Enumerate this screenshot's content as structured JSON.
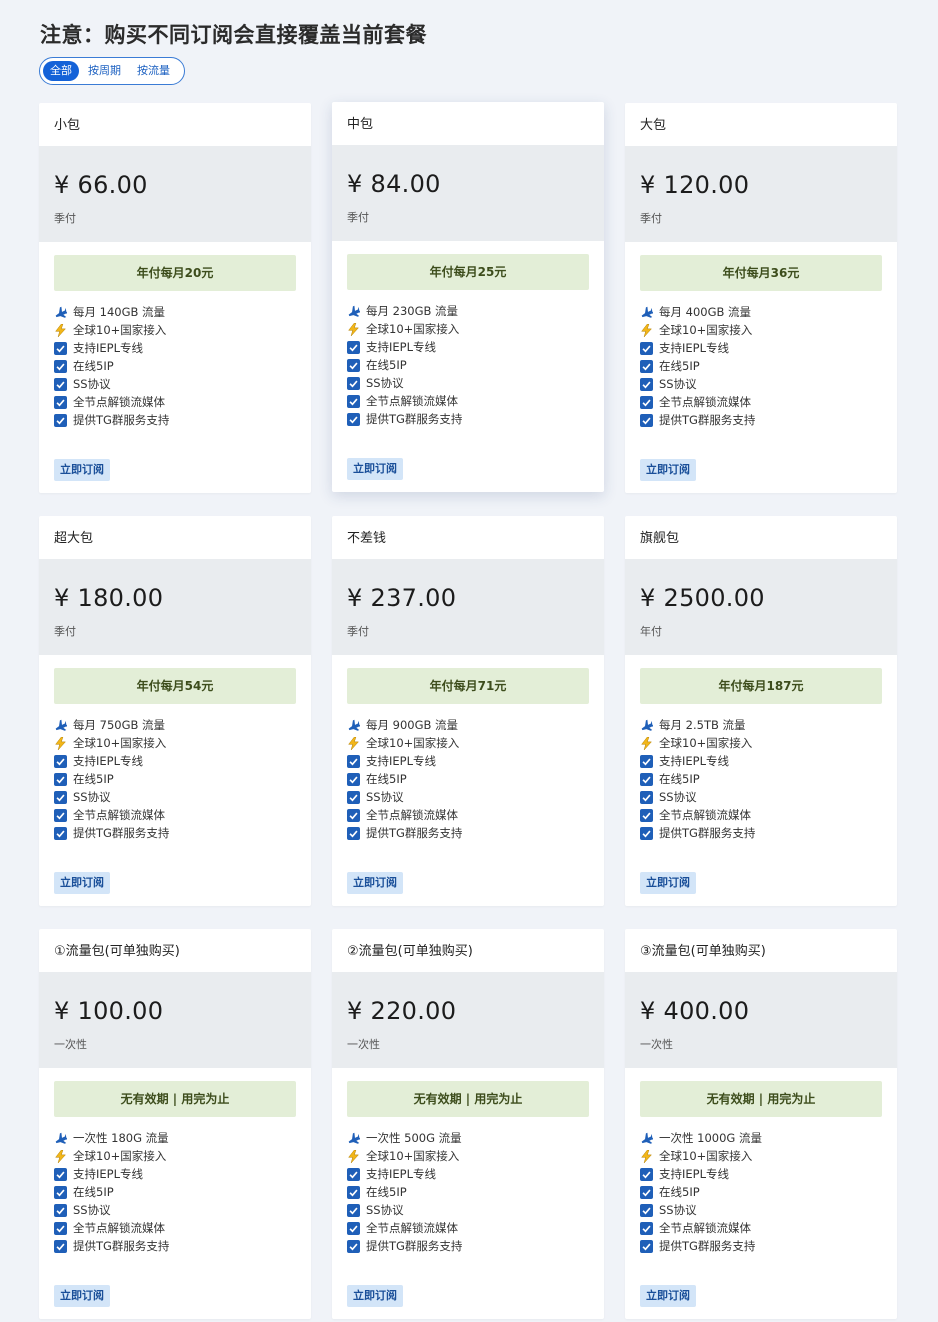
{
  "notice": "注意：购买不同订阅会直接覆盖当前套餐",
  "filter": {
    "tabs": [
      "全部",
      "按周期",
      "按流量"
    ],
    "active": "全部"
  },
  "buy_label": "立即订阅",
  "icon_colors": {
    "check": "#1f5fb8",
    "plane": "#1f5fb8",
    "bolt": "#f2b619"
  },
  "plans": [
    {
      "name": "小包",
      "price": "¥ 66.00",
      "period": "季付",
      "promo": "年付每月20元",
      "features": [
        "每月 140GB 流量",
        "全球10+国家接入",
        "支持IEPL专线",
        "在线5IP",
        "SS协议",
        "全节点解锁流媒体",
        "提供TG群服务支持"
      ]
    },
    {
      "name": "中包",
      "price": "¥ 84.00",
      "period": "季付",
      "promo": "年付每月25元",
      "features": [
        "每月 230GB 流量",
        "全球10+国家接入",
        "支持IEPL专线",
        "在线5IP",
        "SS协议",
        "全节点解锁流媒体",
        "提供TG群服务支持"
      ]
    },
    {
      "name": "大包",
      "price": "¥ 120.00",
      "period": "季付",
      "promo": "年付每月36元",
      "features": [
        "每月 400GB 流量",
        "全球10+国家接入",
        "支持IEPL专线",
        "在线5IP",
        "SS协议",
        "全节点解锁流媒体",
        "提供TG群服务支持"
      ]
    },
    {
      "name": "超大包",
      "price": "¥ 180.00",
      "period": "季付",
      "promo": "年付每月54元",
      "features": [
        "每月 750GB 流量",
        "全球10+国家接入",
        "支持IEPL专线",
        "在线5IP",
        "SS协议",
        "全节点解锁流媒体",
        "提供TG群服务支持"
      ]
    },
    {
      "name": "不差钱",
      "price": "¥ 237.00",
      "period": "季付",
      "promo": "年付每月71元",
      "features": [
        "每月 900GB 流量",
        "全球10+国家接入",
        "支持IEPL专线",
        "在线5IP",
        "SS协议",
        "全节点解锁流媒体",
        "提供TG群服务支持"
      ]
    },
    {
      "name": "旗舰包",
      "price": "¥ 2500.00",
      "period": "年付",
      "promo": "年付每月187元",
      "features": [
        "每月 2.5TB 流量",
        "全球10+国家接入",
        "支持IEPL专线",
        "在线5IP",
        "SS协议",
        "全节点解锁流媒体",
        "提供TG群服务支持"
      ]
    },
    {
      "name": "①流量包(可单独购买)",
      "price": "¥ 100.00",
      "period": "一次性",
      "promo": "无有效期 | 用完为止",
      "features": [
        "一次性 180G 流量",
        "全球10+国家接入",
        "支持IEPL专线",
        "在线5IP",
        "SS协议",
        "全节点解锁流媒体",
        "提供TG群服务支持"
      ]
    },
    {
      "name": "②流量包(可单独购买)",
      "price": "¥ 220.00",
      "period": "一次性",
      "promo": "无有效期 | 用完为止",
      "features": [
        "一次性 500G 流量",
        "全球10+国家接入",
        "支持IEPL专线",
        "在线5IP",
        "SS协议",
        "全节点解锁流媒体",
        "提供TG群服务支持"
      ]
    },
    {
      "name": "③流量包(可单独购买)",
      "price": "¥ 400.00",
      "period": "一次性",
      "promo": "无有效期 | 用完为止",
      "features": [
        "一次性 1000G 流量",
        "全球10+国家接入",
        "支持IEPL专线",
        "在线5IP",
        "SS协议",
        "全节点解锁流媒体",
        "提供TG群服务支持"
      ]
    }
  ]
}
